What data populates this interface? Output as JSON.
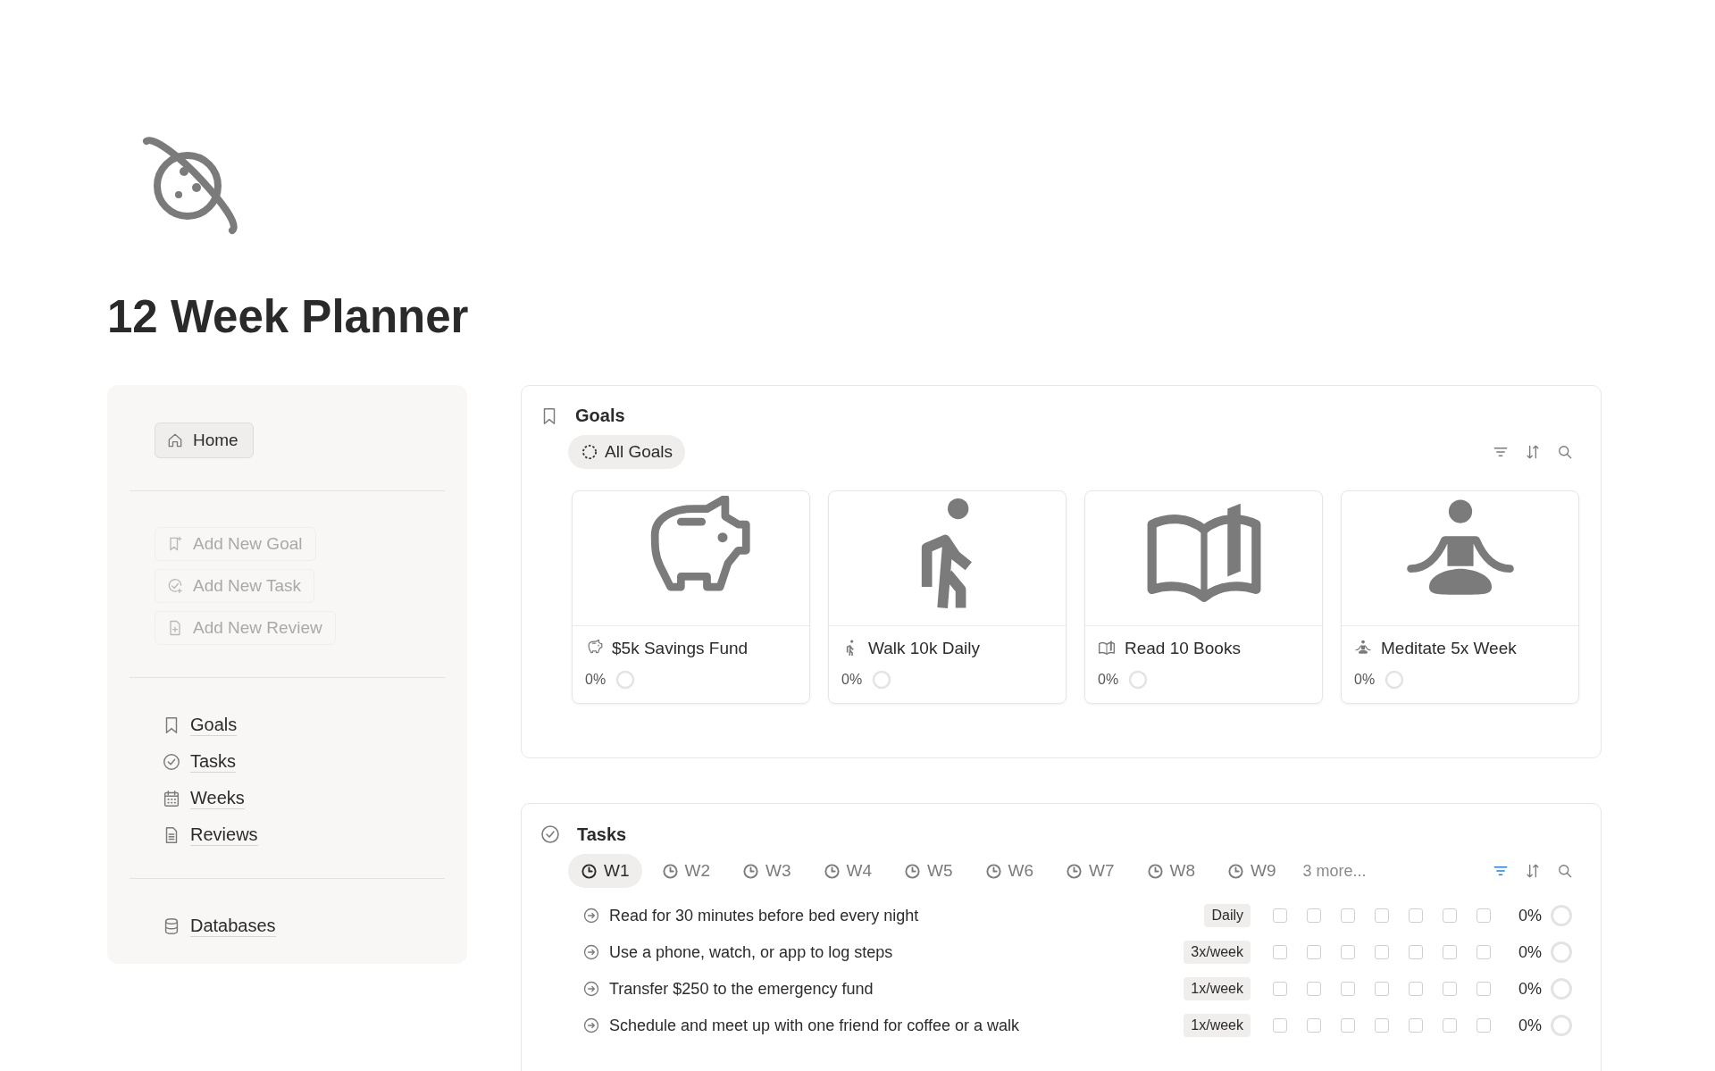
{
  "page": {
    "title": "12 Week Planner"
  },
  "sidebar": {
    "home": {
      "label": "Home",
      "selected": true
    },
    "actions": [
      {
        "label": "Add New Goal",
        "disabled": true
      },
      {
        "label": "Add New Task",
        "disabled": true
      },
      {
        "label": "Add New Review",
        "disabled": true
      }
    ],
    "links": [
      {
        "label": "Goals"
      },
      {
        "label": "Tasks"
      },
      {
        "label": "Weeks"
      },
      {
        "label": "Reviews"
      }
    ],
    "databases": {
      "label": "Databases"
    }
  },
  "goals": {
    "title": "Goals",
    "filter_active": false,
    "views": [
      {
        "label": "All Goals",
        "selected": true
      }
    ],
    "cards": [
      {
        "title": "$5k Savings Fund",
        "percent": "0%"
      },
      {
        "title": "Walk 10k Daily",
        "percent": "0%"
      },
      {
        "title": "Read 10 Books",
        "percent": "0%"
      },
      {
        "title": "Meditate 5x Week",
        "percent": "0%"
      }
    ]
  },
  "tasks": {
    "title": "Tasks",
    "filter_active": true,
    "views": [
      {
        "label": "W1",
        "selected": true
      },
      {
        "label": "W2",
        "selected": false
      },
      {
        "label": "W3",
        "selected": false
      },
      {
        "label": "W4",
        "selected": false
      },
      {
        "label": "W5",
        "selected": false
      },
      {
        "label": "W6",
        "selected": false
      },
      {
        "label": "W7",
        "selected": false
      },
      {
        "label": "W8",
        "selected": false
      },
      {
        "label": "W9",
        "selected": false
      }
    ],
    "more": "3 more...",
    "rows": [
      {
        "text": "Read for 30 minutes before bed every night",
        "frequency": "Daily",
        "days": [
          {
            "checked": false
          },
          {
            "checked": false
          },
          {
            "checked": false
          },
          {
            "checked": false
          },
          {
            "checked": false
          },
          {
            "checked": false
          },
          {
            "checked": false
          }
        ],
        "percent": "0%"
      },
      {
        "text": "Use a phone, watch, or app to log steps",
        "frequency": "3x/week",
        "days": [
          {
            "checked": false
          },
          {
            "checked": false
          },
          {
            "checked": false
          },
          {
            "checked": false
          },
          {
            "checked": false
          },
          {
            "checked": false
          },
          {
            "checked": false
          }
        ],
        "percent": "0%"
      },
      {
        "text": "Transfer $250 to the emergency fund",
        "frequency": "1x/week",
        "days": [
          {
            "checked": false
          },
          {
            "checked": false
          },
          {
            "checked": false
          },
          {
            "checked": false
          },
          {
            "checked": false
          },
          {
            "checked": false
          },
          {
            "checked": false
          }
        ],
        "percent": "0%"
      },
      {
        "text": "Schedule and meet up with one friend for coffee or a walk",
        "frequency": "1x/week",
        "days": [
          {
            "checked": false
          },
          {
            "checked": false
          },
          {
            "checked": false
          },
          {
            "checked": false
          },
          {
            "checked": false
          },
          {
            "checked": false
          },
          {
            "checked": false
          }
        ],
        "percent": "0%"
      }
    ]
  }
}
